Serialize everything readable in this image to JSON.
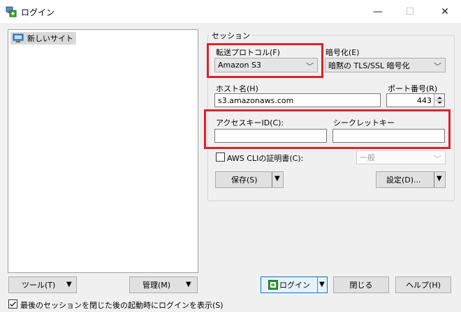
{
  "window": {
    "title": "ログイン",
    "minimize": "—",
    "maximize": "☐",
    "close": "✕"
  },
  "tree": {
    "items": [
      {
        "label": "新しいサイト"
      }
    ]
  },
  "session": {
    "group_label": "セッション",
    "protocol_label": "転送プロトコル(F)",
    "protocol_value": "Amazon S3",
    "encryption_label": "暗号化(E)",
    "encryption_value": "暗黙の TLS/SSL 暗号化",
    "host_label": "ホスト名(H)",
    "host_value": "s3.amazonaws.com",
    "port_label": "ポート番号(R)",
    "port_value": "443",
    "access_key_label": "アクセスキーID(C):",
    "access_key_value": "",
    "secret_key_label": "シークレットキー",
    "secret_key_value": "",
    "aws_cli_label": "AWS CLIの証明書(C):",
    "aws_cli_checked": false,
    "aws_cli_value": "一般",
    "save_label": "保存(S)",
    "settings_label": "設定(D)..."
  },
  "footer": {
    "tools_label": "ツール(T)",
    "manage_label": "管理(M)",
    "login_label": "ログイン",
    "close_label": "閉じる",
    "help_label": "ヘルプ(H)",
    "show_login_label": "最後のセッションを閉じた後の起動時にログインを表示(S)",
    "show_login_checked": true
  },
  "colors": {
    "highlight": "#e0202a",
    "login_icon": "#2e9a2e"
  }
}
